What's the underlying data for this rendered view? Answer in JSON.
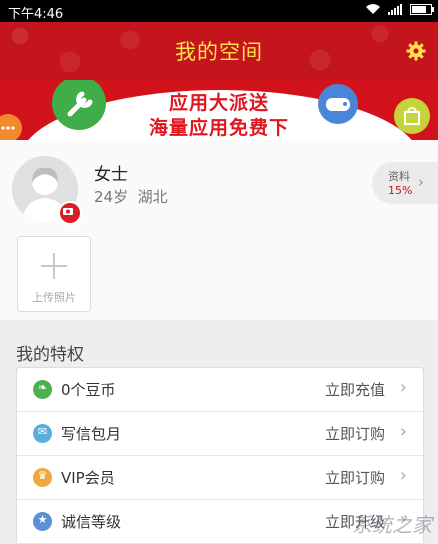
{
  "status_bar": {
    "time": "下午4:46"
  },
  "header": {
    "title": "我的空间",
    "accent": "#c4141c",
    "title_color": "#ffe14a"
  },
  "banner": {
    "line1": "应用大派送",
    "line2": "海量应用免费下"
  },
  "profile": {
    "name": "女士",
    "age": "24岁",
    "location": "湖北",
    "completion_label": "资料",
    "completion_pct": "15%",
    "upload_label": "上传照片"
  },
  "privileges": {
    "title": "我的特权",
    "items": [
      {
        "icon": "leaf-icon",
        "label": "0个豆币",
        "action": "立即充值",
        "color": "#4caf50"
      },
      {
        "icon": "mail-icon",
        "label": "写信包月",
        "action": "立即订购",
        "color": "#5aaedd"
      },
      {
        "icon": "crown-icon",
        "label": "VIP会员",
        "action": "立即订购",
        "color": "#f0a83a"
      },
      {
        "icon": "star-icon",
        "label": "诚信等级",
        "action": "立即升级",
        "color": "#5b8fd6"
      }
    ]
  },
  "watermark": "系统之家"
}
